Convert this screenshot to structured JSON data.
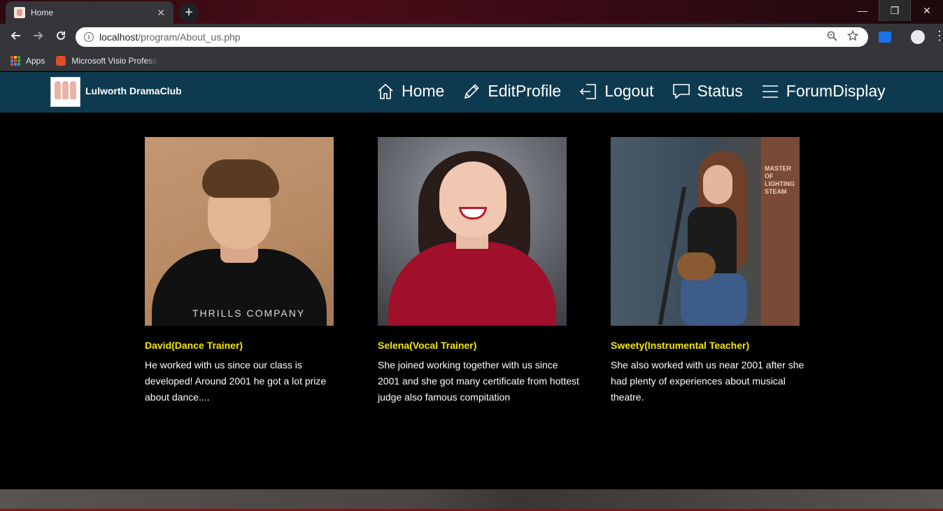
{
  "browser": {
    "tab_title": "Home",
    "tab_close": "✕",
    "new_tab": "+",
    "url_host": "localhost",
    "url_path": "/program/About_us.php",
    "window_controls": {
      "minimize": "—",
      "restore": "❐",
      "close": "✕"
    },
    "bookmarks": [
      {
        "label": "Apps"
      },
      {
        "label": "Microsoft Visio Professi"
      }
    ]
  },
  "site": {
    "brand": "Lulworth DramaClub",
    "nav": [
      {
        "label": "Home",
        "icon": "home-icon"
      },
      {
        "label": "EditProfile",
        "icon": "pencil-icon"
      },
      {
        "label": "Logout",
        "icon": "logout-icon"
      },
      {
        "label": "Status",
        "icon": "chat-bubble-icon"
      },
      {
        "label": "ForumDisplay",
        "icon": "hamburger-icon"
      }
    ]
  },
  "members": [
    {
      "name": "David(Dance Trainer)",
      "description": "He worked with us since our class is developed! Around 2001 he got a lot prize about dance....",
      "shirt_text": "THRILLS COMPANY"
    },
    {
      "name": "Selena(Vocal Trainer)",
      "description": "She joined working together with us since 2001 and she got many certificate from hottest judge also famous compitation"
    },
    {
      "name": "Sweety(Instrumental Teacher)",
      "description": "She also worked with us near 2001 after she had plenty of experiences about musical theatre.",
      "poster_text": "MASTER OF LIGHTING STEAM"
    }
  ],
  "colors": {
    "nav_bg": "#0e3a4f",
    "name_color": "#f5e600",
    "page_bg": "#000000"
  }
}
